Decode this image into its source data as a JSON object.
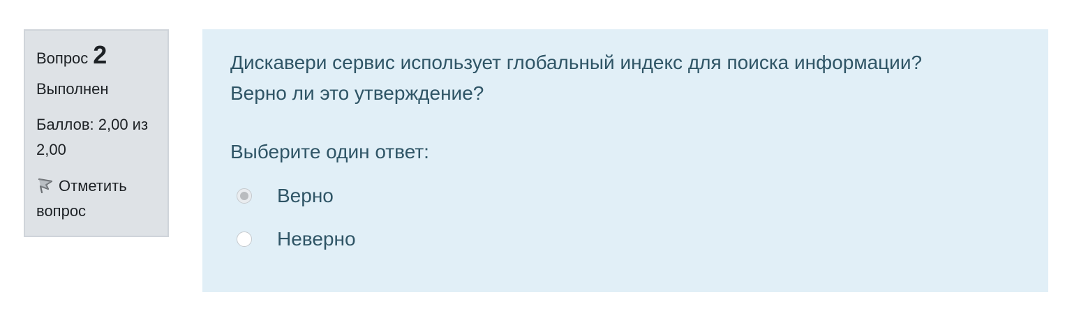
{
  "question_info": {
    "label": "Вопрос",
    "number": "2",
    "state": "Выполнен",
    "grade": "Баллов: 2,00 из 2,00",
    "flag_label": "Отметить вопрос",
    "flag_icon": "flag-icon"
  },
  "question": {
    "text_line1": "Дискавери сервис использует глобальный индекс для поиска информации?",
    "text_line2": "Верно ли это утверждение?",
    "prompt": "Выберите один ответ:",
    "answers": [
      {
        "label": "Верно",
        "checked": true
      },
      {
        "label": "Неверно",
        "checked": false
      }
    ]
  },
  "colors": {
    "info_background": "#dee2e6",
    "content_background": "#e1eff7",
    "content_text": "#2f5566"
  }
}
